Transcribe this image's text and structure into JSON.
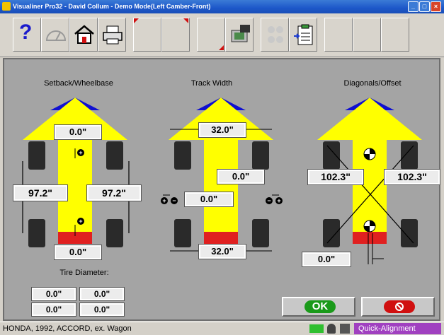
{
  "window": {
    "title": "Visualiner Pro32 - David Collum - Demo Mode(Left Camber-Front)",
    "minimize_label": "_",
    "maximize_label": "□",
    "close_label": "×"
  },
  "toolbar": {
    "help_label": "?"
  },
  "setback": {
    "title": "Setback/Wheelbase",
    "front_setback": "0.0\"",
    "left_wheelbase": "97.2\"",
    "right_wheelbase": "97.2\"",
    "rear_setback": "0.0\""
  },
  "track": {
    "title": "Track Width",
    "front_track": "32.0\"",
    "center_value": "0.0\"",
    "offset_value": "0.0\"",
    "rear_track": "32.0\""
  },
  "diagonals": {
    "title": "Diagonals/Offset",
    "left_diagonal": "102.3\"",
    "right_diagonal": "102.3\"",
    "offset": "0.0\""
  },
  "tire": {
    "title": "Tire Diameter:",
    "values": [
      "0.0\"",
      "0.0\"",
      "0.0\"",
      "0.0\""
    ]
  },
  "actions": {
    "ok_label": "OK"
  },
  "status": {
    "vehicle": "HONDA, 1992, ACCORD, ex. Wagon",
    "mode": "Quick-Alignment"
  },
  "colors": {
    "body_yellow": "#ffff00",
    "front_blue": "#1010d0",
    "rear_red": "#e02020",
    "ok_green": "#1a9a1a",
    "cancel_red": "#d01010",
    "mode_purple": "#a040c0"
  }
}
